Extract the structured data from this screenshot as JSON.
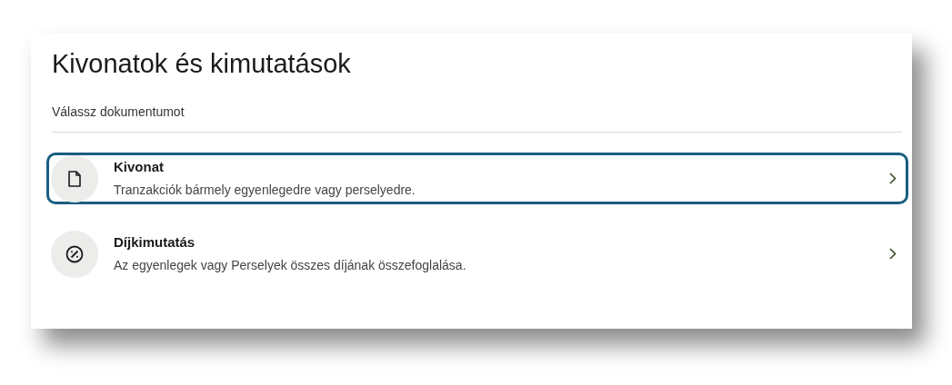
{
  "page": {
    "title": "Kivonatok és kimutatások",
    "subtitle": "Válassz dokumentumot"
  },
  "documents": [
    {
      "kind": "file",
      "title": "Kivonat",
      "description": "Tranzakciók bármely egyenlegedre vagy perselyedre.",
      "selected": true
    },
    {
      "kind": "fee",
      "title": "Díjkimutatás",
      "description": "Az egyenlegek vagy Perselyek összes díjának összefoglalása.",
      "selected": false
    }
  ]
}
